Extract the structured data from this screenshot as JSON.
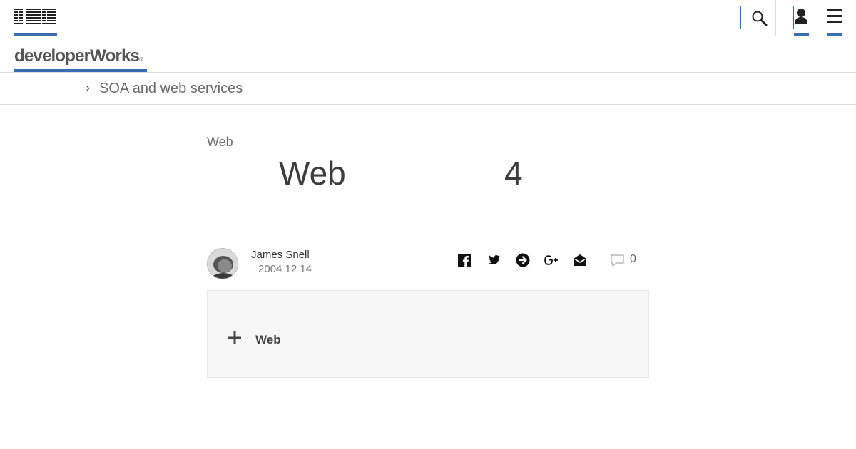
{
  "masthead": {
    "logo_text": "IBM",
    "icons": [
      "search-icon",
      "user-icon",
      "hamburger-menu-icon"
    ]
  },
  "dw": {
    "brand": "developerWorks",
    "registered": "®"
  },
  "breadcrumb": {
    "chevron": "›",
    "label": "SOA and web services"
  },
  "article": {
    "eyebrow": "Web",
    "title_part1": "Web",
    "title_part2": "4"
  },
  "author": {
    "name": "James Snell",
    "date": "2004 12 14"
  },
  "share_icons": [
    "facebook-icon",
    "twitter-icon",
    "arrow-right-circle-icon",
    "google-plus-icon",
    "email-icon"
  ],
  "comments": {
    "count": "0"
  },
  "panel": {
    "label": "Web"
  },
  "colors": {
    "accent": "#3a6db4",
    "panel_bg": "#f7f7f7",
    "border": "#dcdcdc"
  }
}
